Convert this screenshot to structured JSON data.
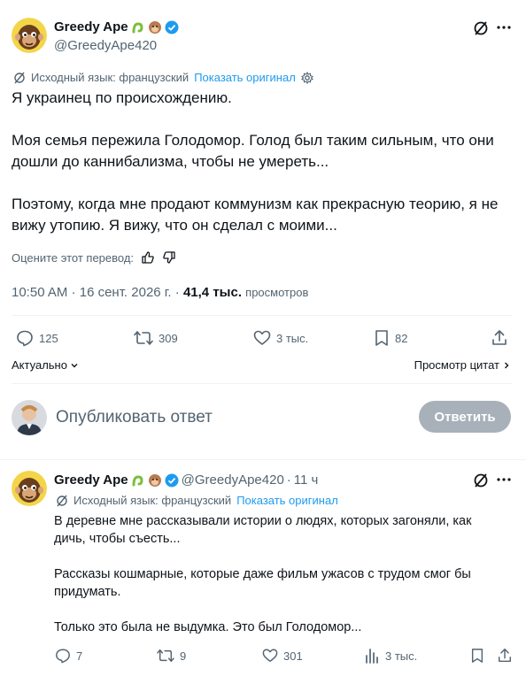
{
  "post": {
    "author_name": "Greedy Ape",
    "author_handle": "@GreedyApe420",
    "translation_note": "Исходный язык: французский",
    "show_original": "Показать оригинал",
    "text": "Я украинец по происхождению.\n\nМоя семья пережила Голодомор. Голод был таким сильным, что они дошли до каннибализма, чтобы не умереть...\n\nПоэтому, когда мне продают коммунизм как прекрасную теорию, я не вижу утопию. Я вижу, что он сделал с моими...",
    "rate_translation": "Оцените этот перевод:",
    "time": "10:50 AM",
    "date": "16 сент. 2026 г.",
    "views_count": "41,4 тыс.",
    "views_label": "просмотров",
    "replies": "125",
    "reposts": "309",
    "likes": "3 тыс.",
    "bookmarks": "82"
  },
  "sort": {
    "relevant": "Актуально",
    "quotes": "Просмотр цитат"
  },
  "composer": {
    "placeholder": "Опубликовать ответ",
    "button": "Ответить"
  },
  "reply": {
    "author_name": "Greedy Ape",
    "author_handle": "@GreedyApe420",
    "age": "11 ч",
    "translation_note": "Исходный язык: французский",
    "show_original": "Показать оригинал",
    "text": "В деревне мне рассказывали истории о людях, которых загоняли, как дичь, чтобы съесть...\n\nРассказы кошмарные, которые даже фильм ужасов с трудом смог бы придумать.\n\nТолько это была не выдумка. Это был Голодомор...",
    "replies": "7",
    "reposts": "9",
    "likes": "301",
    "views": "3 тыс."
  },
  "colors": {
    "accent": "#1d9bf0",
    "muted": "#536471",
    "reply_button": "#a8b1b9",
    "verified": "#1d9bf0"
  },
  "icons": [
    "grok-icon",
    "more-icon",
    "translate-icon",
    "gear-icon",
    "thumbs-up-icon",
    "thumbs-down-icon",
    "reply-icon",
    "repost-icon",
    "like-icon",
    "bookmark-icon",
    "share-icon",
    "views-icon",
    "chevron-down-icon",
    "chevron-right-icon",
    "verified-badge-icon"
  ]
}
